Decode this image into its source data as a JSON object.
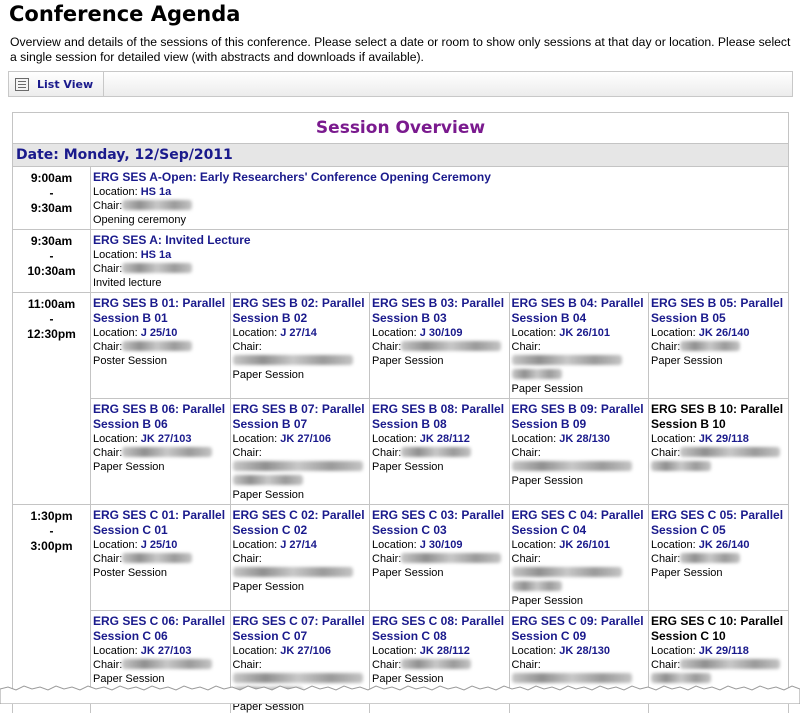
{
  "page": {
    "title": "Conference Agenda",
    "intro": "Overview and details of the sessions of this conference. Please select a date or room to show only sessions at that day or location. Please select a single session for detailed view (with abstracts and downloads if available)."
  },
  "toolbar": {
    "list_view_label": "List View"
  },
  "agenda": {
    "heading": "Session Overview",
    "date_label": "Date: Monday, 12/Sep/2011",
    "labels": {
      "location": "Location:",
      "chair": "Chair:",
      "dash": "-"
    },
    "rows": [
      {
        "start": "9:00am",
        "end": "9:30am",
        "sessions": [
          {
            "title": "ERG SES A-Open: Early Researchers' Conference Opening Ceremony",
            "location": "HS 1a",
            "type": "Opening ceremony"
          }
        ]
      },
      {
        "start": "9:30am",
        "end": "10:30am",
        "sessions": [
          {
            "title": "ERG SES A: Invited Lecture",
            "location": "HS 1a",
            "type": "Invited lecture"
          }
        ]
      },
      {
        "start": "11:00am",
        "end": "12:30pm",
        "sessions": [
          {
            "title": "ERG SES B 01: Parallel Session B 01",
            "location": "J 25/10",
            "type": "Poster Session"
          },
          {
            "title": "ERG SES B 02: Parallel Session B 02",
            "location": "J 27/14",
            "type": "Paper Session"
          },
          {
            "title": "ERG SES B 03: Parallel Session B 03",
            "location": "J 30/109",
            "type": "Paper Session"
          },
          {
            "title": "ERG SES B 04: Parallel Session B 04",
            "location": "JK 26/101",
            "type": "Paper Session"
          },
          {
            "title": "ERG SES B 05: Parallel Session B 05",
            "location": "JK 26/140",
            "type": "Paper Session"
          },
          {
            "title": "ERG SES B 06: Parallel Session B 06",
            "location": "JK 27/103",
            "type": "Paper Session"
          },
          {
            "title": "ERG SES B 07: Parallel Session B 07",
            "location": "JK 27/106",
            "type": "Paper Session"
          },
          {
            "title": "ERG SES B 08: Parallel Session B 08",
            "location": "JK 28/112",
            "type": "Paper Session"
          },
          {
            "title": "ERG SES B 09: Parallel Session B 09",
            "location": "JK 28/130",
            "type": "Paper Session"
          },
          {
            "title": "ERG SES B 10: Parallel Session B 10",
            "location": "JK 29/118",
            "type": ""
          }
        ]
      },
      {
        "start": "1:30pm",
        "end": "3:00pm",
        "sessions": [
          {
            "title": "ERG SES C 01: Parallel Session C 01",
            "location": "J 25/10",
            "type": "Poster Session"
          },
          {
            "title": "ERG SES C 02: Parallel Session C 02",
            "location": "J 27/14",
            "type": "Paper Session"
          },
          {
            "title": "ERG SES C 03: Parallel Session C 03",
            "location": "J 30/109",
            "type": "Paper Session"
          },
          {
            "title": "ERG SES C 04: Parallel Session C 04",
            "location": "JK 26/101",
            "type": "Paper Session"
          },
          {
            "title": "ERG SES C 05: Parallel Session C 05",
            "location": "JK 26/140",
            "type": "Paper Session"
          },
          {
            "title": "ERG SES C 06: Parallel Session C 06",
            "location": "JK 27/103",
            "type": "Paper Session"
          },
          {
            "title": "ERG SES C 07: Parallel Session C 07",
            "location": "JK 27/106",
            "type": "Paper Session"
          },
          {
            "title": "ERG SES C 08: Parallel Session C 08",
            "location": "JK 28/112",
            "type": "Paper Session"
          },
          {
            "title": "ERG SES C 09: Parallel Session C 09",
            "location": "JK 28/130",
            "type": "Paper Session"
          },
          {
            "title": "ERG SES C 10: Parallel Session C 10",
            "location": "JK 29/118",
            "type": ""
          }
        ]
      }
    ]
  }
}
